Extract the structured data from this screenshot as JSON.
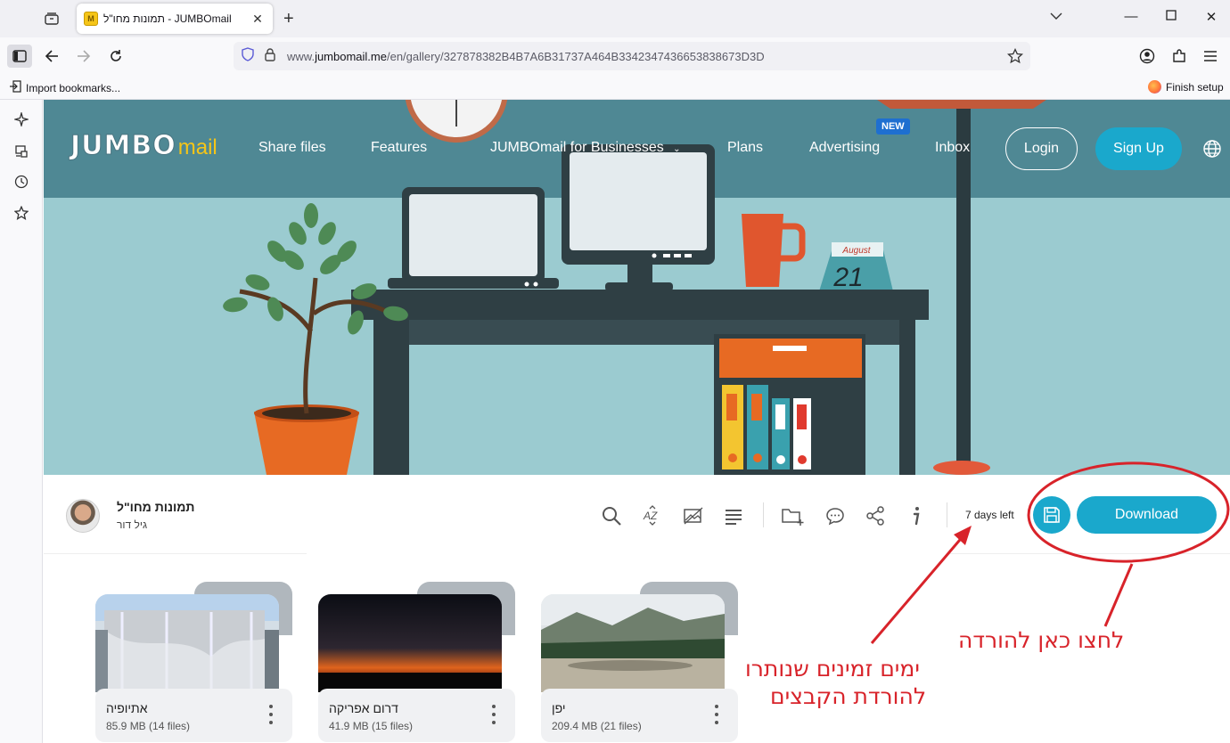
{
  "browser": {
    "tab_title": "תמונות מחו\"ל - JUMBOmail",
    "url_prefix": "www.",
    "url_domain": "jumbomail.me",
    "url_path": "/en/gallery/327878382B4B7A6B31737A464B3342347436653838673D3D",
    "bookmarks": {
      "import_label": "Import bookmarks...",
      "finish_label": "Finish setup"
    },
    "icons": [
      "tab-list-icon",
      "jumbomail-favicon",
      "close-icon",
      "new-tab-icon",
      "chevron-down-icon",
      "minimize-icon",
      "maximize-icon",
      "window-close-icon",
      "sidebar-icon",
      "back-icon",
      "forward-icon",
      "reload-icon",
      "shield-icon",
      "lock-icon",
      "star-icon",
      "account-icon",
      "extensions-icon",
      "menu-icon",
      "ai-chat-icon",
      "synced-tabs-icon",
      "history-icon",
      "bookmarks-icon"
    ]
  },
  "site": {
    "logo_main": "JUMBO",
    "logo_sub": "mail",
    "nav": {
      "share": "Share files",
      "features": "Features",
      "business": "JUMBOmail for Businesses",
      "plans": "Plans",
      "advertising": "Advertising",
      "new_badge": "NEW",
      "inbox": "Inbox",
      "login": "Login",
      "signup": "Sign Up"
    },
    "hero_calendar": {
      "month": "August",
      "day": "21"
    }
  },
  "gallery": {
    "title": "תמונות מחו\"ל",
    "owner": "גיל דור",
    "days_left": "7 days left",
    "download_label": "Download",
    "accent_color": "#1aa8cc",
    "cards": [
      {
        "name": "אתיופיה",
        "meta": "85.9 MB (14 files)"
      },
      {
        "name": "דרום אפריקה",
        "meta": "41.9 MB (15 files)"
      },
      {
        "name": "יפן",
        "meta": "209.4 MB (21 files)"
      }
    ]
  },
  "annotations": {
    "color": "#d8232a",
    "click_here": "לחצו כאן להורדה",
    "days_line1": "ימים זמינים שנותרו",
    "days_line2": "להורדת הקבצים"
  }
}
